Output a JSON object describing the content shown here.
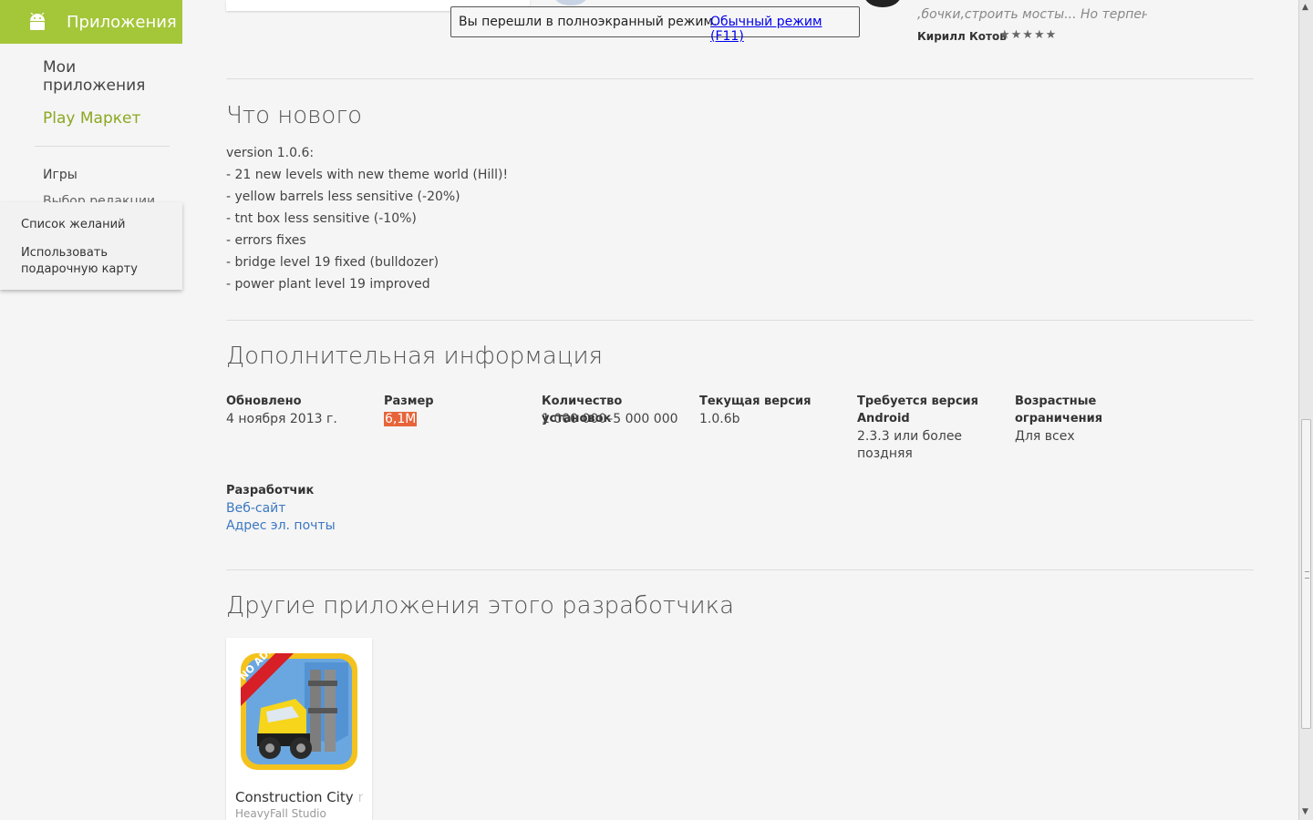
{
  "sidebar": {
    "header_title": "Приложения",
    "my_apps": "Мои приложения",
    "play_market": "Play Маркет",
    "games": "Игры",
    "editors_choice": "Выбор редакции",
    "dropdown": {
      "wishlist": "Список желаний",
      "redeem": "Использовать подарочную карту"
    }
  },
  "fullscreen_notice": {
    "message": "Вы перешли в полноэкранный режим.",
    "link": "Обычный режим (F11)"
  },
  "review": {
    "text": ",бочки,строить мосты... Но терпение",
    "author": "Кирилл Котов",
    "stars": "★★★★★",
    "rating": 5
  },
  "whats_new": {
    "title": "Что нового",
    "lines": [
      "version 1.0.6:",
      "- 21 new levels with new theme world (Hill)!",
      "- yellow barrels less sensitive (-20%)",
      "- tnt box less sensitive (-10%)",
      "- errors fixes",
      "- bridge level 19 fixed (bulldozer)",
      "- power plant level 19 improved"
    ]
  },
  "additional_info": {
    "title": "Дополнительная информация",
    "updated_label": "Обновлено",
    "updated_value": "4 ноября 2013 г.",
    "size_label": "Размер",
    "size_value": "6,1M",
    "installs_label": "Количество установок",
    "installs_value": "1 000 000–5 000 000",
    "version_label": "Текущая версия",
    "version_value": "1.0.6b",
    "requires_label": "Требуется версия Android",
    "requires_value": "2.3.3 или более поздняя",
    "content_label": "Возрастные ограничения",
    "content_value": "Для всех",
    "developer_label": "Разработчик",
    "website_link": "Веб-сайт",
    "email_link": "Адрес эл. почты"
  },
  "other_apps": {
    "title": "Другие приложения этого разработчика",
    "apps": [
      {
        "name": "Construction City",
        "name_faded": " no",
        "developer": "HeavyFall Studio",
        "badge": "NO ADS"
      }
    ]
  },
  "colors": {
    "android_green": "#a4c639",
    "link_blue": "#3b78c2",
    "highlight": "#e7643a"
  }
}
